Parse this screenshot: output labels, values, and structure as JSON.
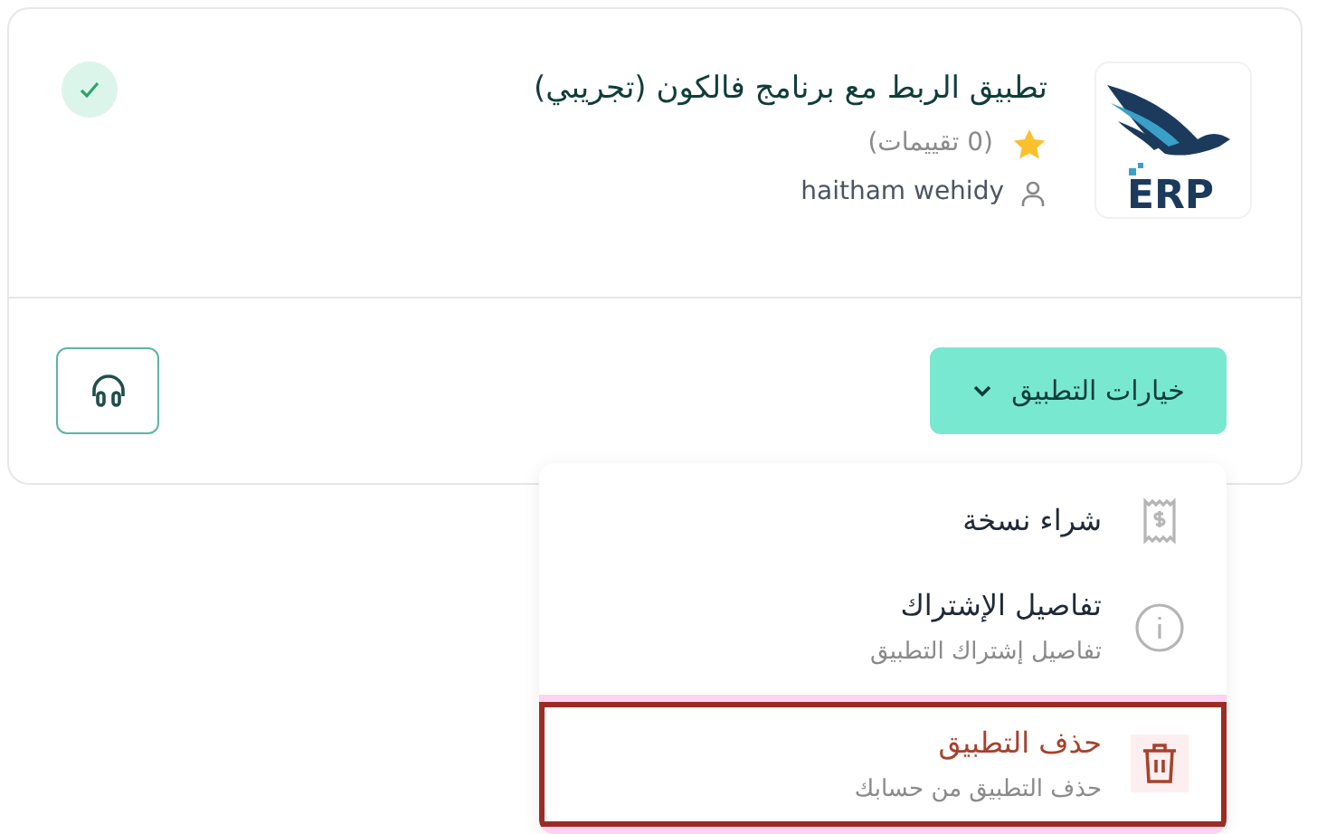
{
  "app": {
    "logo_text": "ERP",
    "title": "تطبيق الربط مع برنامج فالكون (تجريبي)",
    "ratings": "(0 تقييمات)",
    "author": "haitham wehidy",
    "installed": true
  },
  "options_button": {
    "label": "خيارات التطبيق",
    "expanded": true
  },
  "menu": [
    {
      "kind": "receipt",
      "label": "شراء نسخة",
      "highlighted": false
    },
    {
      "kind": "info",
      "label": "تفاصيل الإشتراك",
      "description": "تفاصيل إشتراك التطبيق",
      "highlighted": false
    },
    {
      "kind": "trash",
      "label": "حذف التطبيق",
      "description": "حذف التطبيق من حسابك",
      "highlighted": true,
      "danger": true
    }
  ]
}
